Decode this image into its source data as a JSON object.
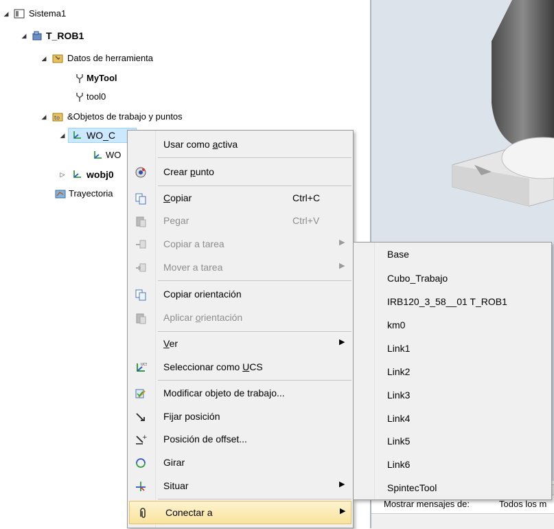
{
  "tree": {
    "system": "Sistema1",
    "task": "T_ROB1",
    "tooldata": "Datos de herramienta",
    "mytool": "MyTool",
    "tool0": "tool0",
    "wobjs": "&Objetos de trabajo y puntos",
    "wo_c": "WO_C",
    "wo_sub": "WO",
    "wobj0": "wobj0",
    "paths": "Trayectoria"
  },
  "bottom": {
    "show_label": "Mostrar mensajes de:",
    "show_value": "Todos los m"
  },
  "context_menu": {
    "use_active": [
      "Usar como ",
      "a",
      "ctiva"
    ],
    "create_point": [
      "Crear ",
      "p",
      "unto"
    ],
    "copy": [
      "",
      "C",
      "opiar"
    ],
    "copy_shortcut": "Ctrl+C",
    "paste": "Pegar",
    "paste_shortcut": "Ctrl+V",
    "copy_to_task": "Copiar a tarea",
    "move_to_task": "Mover a tarea",
    "copy_orientation": "Copiar orientación",
    "apply_orientation": [
      "Aplicar ",
      "o",
      "rientación"
    ],
    "view": [
      "",
      "V",
      "er"
    ],
    "set_ucs": [
      "Seleccionar como ",
      "U",
      "CS"
    ],
    "modify_wobj": "Modificar objeto de trabajo...",
    "set_position": "Fijar posición",
    "offset_position": "Posición de offset...",
    "rotate": "Girar",
    "place": "Situar",
    "attach_to": "Conectar a"
  },
  "submenu": {
    "items": [
      "Base",
      "Cubo_Trabajo",
      "IRB120_3_58__01 T_ROB1",
      "km0",
      "Link1",
      "Link2",
      "Link3",
      "Link4",
      "Link5",
      "Link6",
      "SpintecTool"
    ]
  }
}
